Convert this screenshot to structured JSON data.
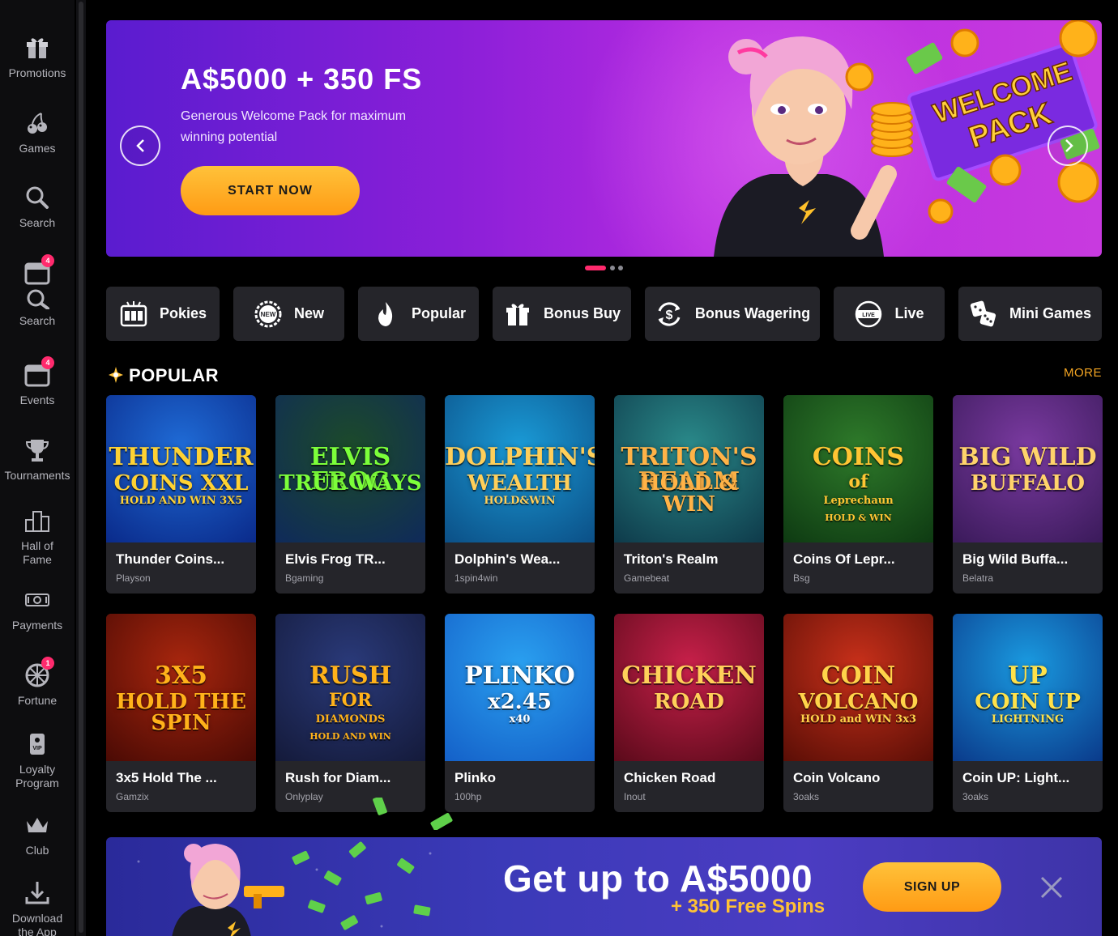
{
  "sidebar": {
    "items": [
      {
        "label": "Promotions",
        "icon": "gift-icon"
      },
      {
        "label": "Games",
        "icon": "cherries-icon"
      },
      {
        "label": "Search",
        "icon": "search-icon"
      },
      {
        "label": "Search",
        "icon": "calendar-search-icon",
        "badge": "4"
      },
      {
        "label": "Events",
        "icon": "calendar-icon",
        "badge": "4"
      },
      {
        "label": "Tournaments",
        "icon": "trophy-icon"
      },
      {
        "label": "Hall of Fame",
        "icon": "podium-icon"
      },
      {
        "label": "Payments",
        "icon": "card-icon"
      },
      {
        "label": "Fortune",
        "icon": "wheel-icon",
        "badge": "1"
      },
      {
        "label": "Loyalty Program",
        "icon": "vip-icon"
      },
      {
        "label": "Club",
        "icon": "crown-icon"
      },
      {
        "label": "Download the App",
        "icon": "download-icon"
      }
    ]
  },
  "hero": {
    "title": "A$5000 + 350 FS",
    "subtitle": "Generous Welcome Pack for maximum winning potential",
    "cta": "START NOW",
    "art_line1": "WELCOME",
    "art_line2": "PACK",
    "active_slide": 1,
    "slide_count": 3
  },
  "categories": [
    {
      "label": "Pokies",
      "icon": "slot-machine-icon"
    },
    {
      "label": "New",
      "icon": "new-badge-icon"
    },
    {
      "label": "Popular",
      "icon": "flame-icon"
    },
    {
      "label": "Bonus Buy",
      "icon": "gift-box-icon"
    },
    {
      "label": "Bonus Wagering",
      "icon": "dollar-cycle-icon"
    },
    {
      "label": "Live",
      "icon": "live-icon"
    },
    {
      "label": "Mini Games",
      "icon": "dice-icon"
    }
  ],
  "section": {
    "title": "POPULAR",
    "more": "MORE"
  },
  "games": [
    {
      "name": "Thunder Coins...",
      "provider": "Playson",
      "art": [
        "THUNDER",
        "COINS XXL",
        "HOLD AND WIN 3X5"
      ],
      "bg": "#1f6bd6",
      "bg2": "#0a2a8a",
      "fg": "#ffd233"
    },
    {
      "name": "Elvis Frog TR...",
      "provider": "Bgaming",
      "art": [
        "ELVIS FROG",
        "TRUE WAYS"
      ],
      "bg": "#1c4a2a",
      "bg2": "#0f2a5a",
      "fg": "#7cff3a"
    },
    {
      "name": "Dolphin's Wea...",
      "provider": "1spin4win",
      "art": [
        "DOLPHIN'S",
        "WEALTH",
        "HOLD&WIN"
      ],
      "bg": "#1a9ad6",
      "bg2": "#0b4f86",
      "fg": "#ffcf5a"
    },
    {
      "name": "Triton's Realm",
      "provider": "Gamebeat",
      "art": [
        "TRITON'S REALM",
        "HOLD & WIN"
      ],
      "bg": "#2a8a8a",
      "bg2": "#0e3a4a",
      "fg": "#ffb347"
    },
    {
      "name": "Coins Of Lepr...",
      "provider": "Bsg",
      "art": [
        "COINS",
        "of",
        "Leprechaun",
        "HOLD & WIN"
      ],
      "bg": "#2e7a2a",
      "bg2": "#0e3a12",
      "fg": "#ffc533"
    },
    {
      "name": "Big Wild Buffa...",
      "provider": "Belatra",
      "art": [
        "BIG WILD",
        "BUFFALO"
      ],
      "bg": "#7a3aa0",
      "bg2": "#3a1a5a",
      "fg": "#ffd36b"
    },
    {
      "name": "3x5 Hold The ...",
      "provider": "Gamzix",
      "art": [
        "3X5",
        "HOLD THE SPIN"
      ],
      "bg": "#a8260e",
      "bg2": "#4a0a04",
      "fg": "#ffb21a"
    },
    {
      "name": "Rush for Diam...",
      "provider": "Onlyplay",
      "art": [
        "RUSH",
        "FOR",
        "DIAMONDS",
        "HOLD AND WIN"
      ],
      "bg": "#2a3a7a",
      "bg2": "#141a3a",
      "fg": "#ffb21a"
    },
    {
      "name": "Plinko",
      "provider": "100hp",
      "art": [
        "PLINKO",
        "x2.45",
        "x40"
      ],
      "bg": "#2aa0f0",
      "bg2": "#1460c8",
      "fg": "#ffffff"
    },
    {
      "name": "Chicken Road",
      "provider": "Inout",
      "art": [
        "CHICKEN",
        "ROAD"
      ],
      "bg": "#c8204a",
      "bg2": "#5a0a1a",
      "fg": "#ffd05a"
    },
    {
      "name": "Coin Volcano",
      "provider": "3oaks",
      "art": [
        "COIN",
        "VOLCANO",
        "HOLD and WIN 3x3"
      ],
      "bg": "#c8301a",
      "bg2": "#5a0e06",
      "fg": "#ffd34a"
    },
    {
      "name": "Coin UP: Light...",
      "provider": "3oaks",
      "art": [
        "UP",
        "COIN UP",
        "LIGHTNING"
      ],
      "bg": "#1a9ae0",
      "bg2": "#0a3a8a",
      "fg": "#ffe14a"
    }
  ],
  "promo": {
    "headline": "Get up to A$5000",
    "sub": "+ 350 Free Spins",
    "cta": "SIGN UP"
  },
  "colors": {
    "accent": "#f5a623",
    "badge": "#ff2a6d",
    "chip_bg": "#25252a",
    "card_bg": "#25252a"
  }
}
